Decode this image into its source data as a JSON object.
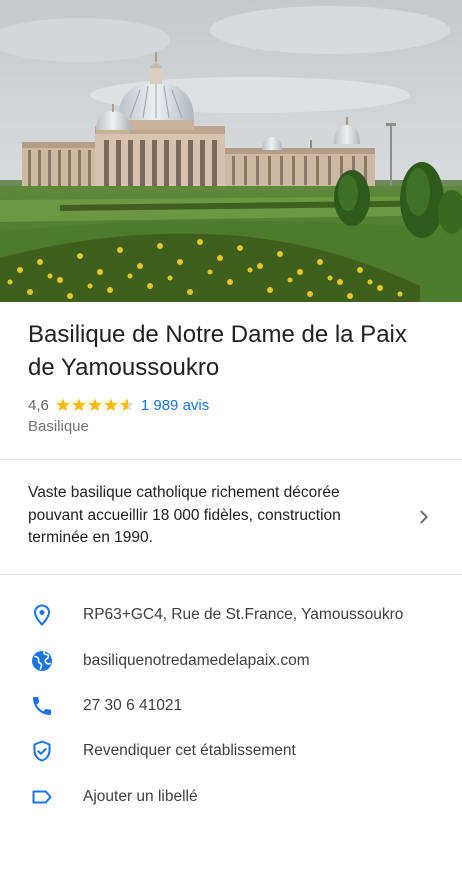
{
  "place": {
    "name": "Basilique de Notre Dame de la Paix de Yamoussoukro",
    "rating": "4,6",
    "stars": 4.6,
    "reviews": "1 989 avis",
    "category": "Basilique"
  },
  "description": "Vaste basilique catholique richement décorée pouvant accueillir 18 000 fidèles, construction terminée en 1990.",
  "info": {
    "address": "RP63+GC4, Rue de St.France, Yamoussoukro",
    "website": "basiliquenotredamedelapaix.com",
    "phone": "27 30 6 41021",
    "claim": "Revendiquer cet établissement",
    "label": "Ajouter un libellé"
  },
  "icons": {
    "address": "location-pin-icon",
    "website": "globe-icon",
    "phone": "phone-icon",
    "claim": "shield-check-icon",
    "label": "label-tag-icon",
    "more": "chevron-right-icon"
  },
  "colors": {
    "accent": "#1a73e8",
    "star": "#fbbc04",
    "text": "#202124",
    "secondary": "#70757a"
  }
}
